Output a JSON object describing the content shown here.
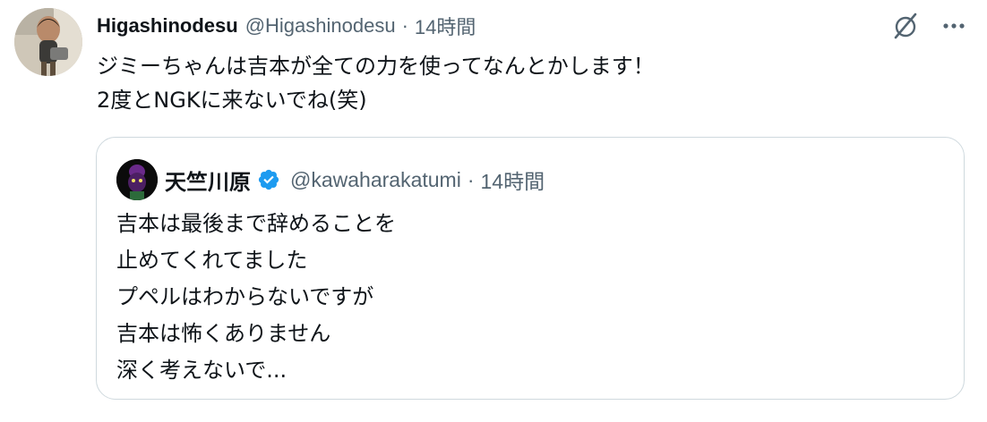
{
  "tweet": {
    "author": {
      "display_name": "Higashinodesu",
      "handle": "@Higashinodesu",
      "separator": "·",
      "time": "14時間",
      "avatar_icon": "user-avatar"
    },
    "text_lines": [
      "ジミーちゃんは吉本が全ての力を使ってなんとかします！",
      "2度とNGKに来ないでね(笑)"
    ],
    "actions": {
      "grok_icon": "grok-icon",
      "more_icon": "more-icon"
    }
  },
  "quote": {
    "author": {
      "display_name": "天竺川原",
      "handle": "@kawaharakatumi",
      "separator": "·",
      "time": "14時間",
      "verified": true,
      "verified_color": "#1d9bf0"
    },
    "text_lines": [
      "吉本は最後まで辞めることを",
      "止めてくれてました",
      "プペルはわからないですが",
      "吉本は怖くありません",
      "深く考えないで..."
    ]
  },
  "colors": {
    "text_primary": "#0f1419",
    "text_secondary": "#536471",
    "border": "#cfd9de",
    "verified": "#1d9bf0"
  }
}
